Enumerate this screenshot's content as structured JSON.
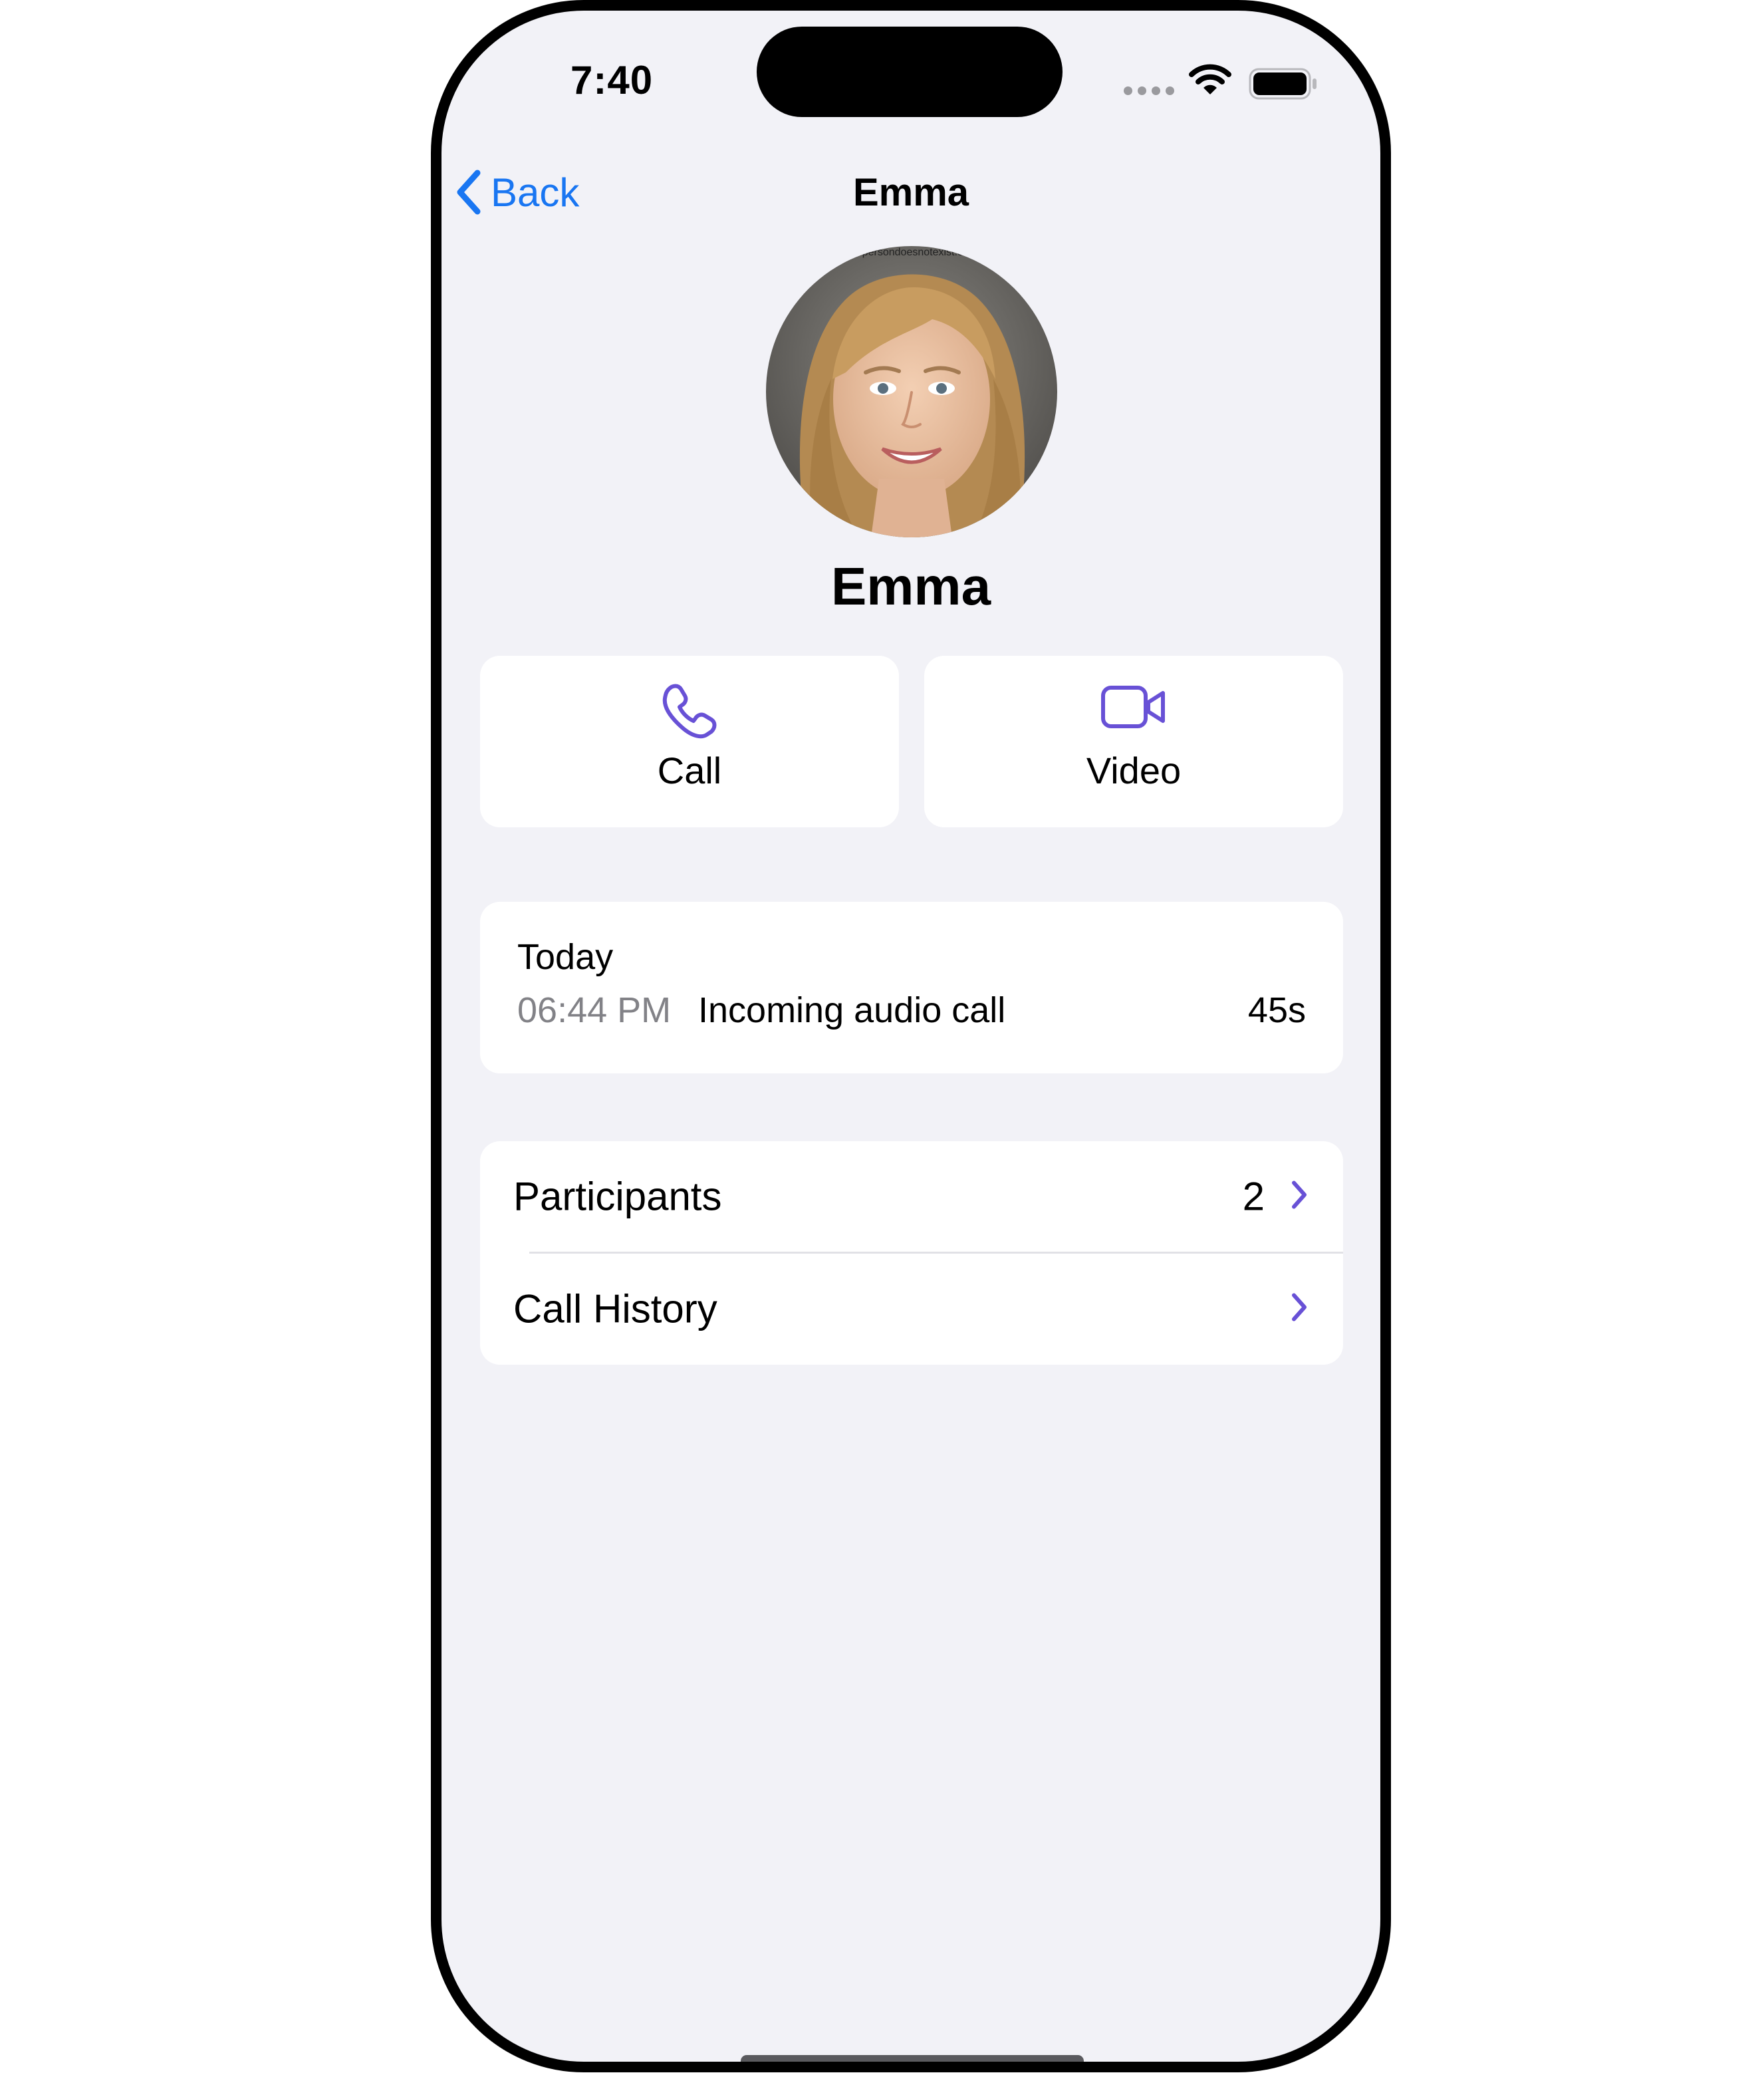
{
  "status_bar": {
    "time": "7:40"
  },
  "nav": {
    "back_label": "Back",
    "title": "Emma"
  },
  "contact": {
    "name": "Emma",
    "avatar": "profile-photo",
    "avatar_watermark": "thispersondoesnotexist.com"
  },
  "actions": [
    {
      "label": "Call",
      "icon": "phone-icon"
    },
    {
      "label": "Video",
      "icon": "video-camera-icon"
    }
  ],
  "history": {
    "day": "Today",
    "time": "06:44 PM",
    "description": "Incoming audio call",
    "duration": "45s"
  },
  "list": {
    "participants_label": "Participants",
    "participants_count": "2",
    "call_history_label": "Call History"
  },
  "colors": {
    "accent": "#6851d6",
    "link": "#1976f2",
    "background": "#f2f2f7",
    "card": "#ffffff",
    "secondary_text": "#828287"
  }
}
